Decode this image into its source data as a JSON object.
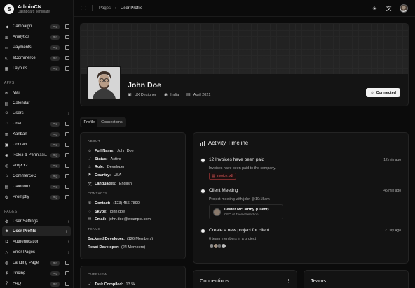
{
  "brand": {
    "name": "AdminCN",
    "subtitle": "Dashboard Template",
    "logo_letter": "S"
  },
  "sidebar": {
    "items_top": [
      {
        "label": "Campaign",
        "icon": "megaphone-icon",
        "badge": "Pro",
        "external": true
      },
      {
        "label": "Analytics",
        "icon": "chart-icon",
        "badge": "Pro",
        "external": true
      },
      {
        "label": "Payments",
        "icon": "card-icon",
        "badge": "Pro",
        "external": true
      },
      {
        "label": "eCommerce",
        "icon": "cart-icon",
        "badge": "Pro",
        "external": true
      },
      {
        "label": "Layouts",
        "icon": "layout-icon",
        "badge": "Pro",
        "external": true
      }
    ],
    "apps_label": "APPS",
    "apps": [
      {
        "label": "Mail",
        "icon": "mail-icon"
      },
      {
        "label": "Calendar",
        "icon": "calendar-icon"
      },
      {
        "label": "Users",
        "icon": "users-icon",
        "chevron": true
      },
      {
        "label": "Chat",
        "icon": "chat-icon",
        "badge": "Pro",
        "external": true
      },
      {
        "label": "Kanban",
        "icon": "kanban-icon",
        "badge": "Pro",
        "external": true
      },
      {
        "label": "Contact",
        "icon": "contact-icon",
        "badge": "Pro",
        "external": true
      },
      {
        "label": "Roles & Permissi...",
        "icon": "shield-icon",
        "badge": "Pro",
        "external": true
      },
      {
        "label": "ProjXYZ",
        "icon": "project-icon",
        "badge": "Pro",
        "external": true
      },
      {
        "label": "CommerceO",
        "icon": "store-icon",
        "badge": "Pro",
        "external": true
      },
      {
        "label": "Calendrix",
        "icon": "calendar-icon",
        "badge": "Pro",
        "external": true
      },
      {
        "label": "Promptly",
        "icon": "prompt-icon",
        "badge": "Pro",
        "external": true
      }
    ],
    "pages_label": "PAGES",
    "pages": [
      {
        "label": "User Settings",
        "icon": "settings-icon",
        "chevron": true
      },
      {
        "label": "User Profile",
        "icon": "user-icon",
        "chevron": true,
        "active": true
      },
      {
        "label": "Authentication",
        "icon": "lock-icon",
        "chevron": true
      },
      {
        "label": "Error Pages",
        "icon": "alert-icon",
        "chevron": true
      },
      {
        "label": "Landing Page",
        "icon": "globe-icon",
        "badge": "Pro",
        "external": true
      },
      {
        "label": "Pricing",
        "icon": "dollar-icon",
        "badge": "Pro",
        "external": true
      },
      {
        "label": "FAQ",
        "icon": "help-icon",
        "badge": "Pro",
        "external": true
      }
    ]
  },
  "breadcrumb": {
    "root": "Pages",
    "current": "User Profile"
  },
  "profile": {
    "name": "John Doe",
    "role": "UX Designer",
    "location": "India",
    "joined": "April 2021",
    "connect_label": "Connected"
  },
  "tabs": [
    "Profile",
    "Connections"
  ],
  "about": {
    "about_label": "ABOUT",
    "rows": [
      {
        "icon": "user-icon",
        "key": "Full Name:",
        "value": "John Doe"
      },
      {
        "icon": "check-icon",
        "key": "Status:",
        "value": "Active"
      },
      {
        "icon": "star-icon",
        "key": "Role:",
        "value": "Developer"
      },
      {
        "icon": "flag-icon",
        "key": "Country:",
        "value": "USA"
      },
      {
        "icon": "language-icon",
        "key": "Languages:",
        "value": "English"
      }
    ],
    "contacts_label": "CONTACTS",
    "contacts": [
      {
        "icon": "phone-icon",
        "key": "Contact:",
        "value": "(123) 456-7890"
      },
      {
        "icon": "chat-icon",
        "key": "Skype:",
        "value": "john.doe"
      },
      {
        "icon": "mail-icon",
        "key": "Email:",
        "value": "john.doe@example.com"
      }
    ],
    "teams_label": "TEAMS",
    "teams": [
      {
        "name": "Backend Developer:",
        "members": "(126 Members)"
      },
      {
        "name": "React Developer:",
        "members": "(24 Members)"
      }
    ]
  },
  "timeline": {
    "title": "Activity Timeline",
    "items": [
      {
        "title": "12 Invoices have been paid",
        "time": "12 min ago",
        "desc": "Invoices have been paid to the company.",
        "attachment": "invoice.pdf"
      },
      {
        "title": "Client Meeting",
        "time": "45 min ago",
        "desc": "Project meeting with john @10:15am",
        "person_name": "Lester McCarthy (Client)",
        "person_role": "CEO of ThemeSelection"
      },
      {
        "title": "Create a new project for client",
        "time": "2 Day Ago",
        "desc": "6 team members in a project"
      }
    ]
  },
  "overview": {
    "label": "OVERVIEW",
    "task_key": "Task Compiled:",
    "task_value": "13.5k"
  },
  "connections_card": {
    "title": "Connections"
  },
  "teams_card": {
    "title": "Teams"
  },
  "colors": {
    "accent": "#f2f2f2",
    "pdf": "#e05a5a",
    "background": "#0b0b0b"
  }
}
